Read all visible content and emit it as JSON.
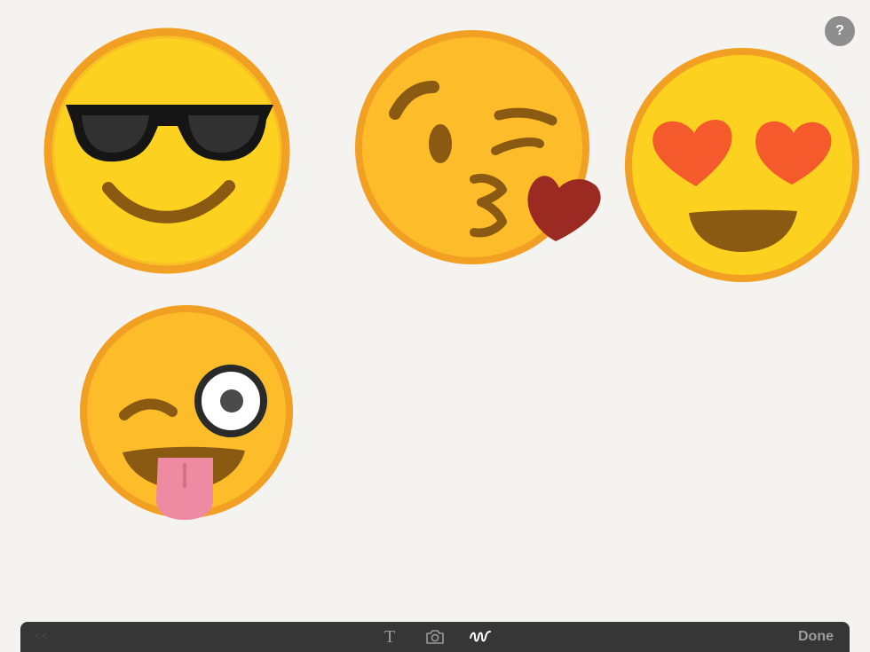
{
  "help": {
    "label": "?"
  },
  "toolbar": {
    "back_label": "<<",
    "text_tool_label": "T",
    "done_label": "Done",
    "tools": [
      "text-icon",
      "camera-icon",
      "draw-icon"
    ],
    "active_tool": "draw"
  },
  "drawing": {
    "items": [
      "cool-face-sunglasses",
      "face-blowing-kiss",
      "heart-eyes-face",
      "winking-tongue-face"
    ]
  },
  "colors": {
    "background": "#f5f3f0",
    "face_fill": "#fdd11f",
    "face_outline": "#f2a024",
    "mouth": "#8a5a12",
    "heart_red": "#f55a2d",
    "kiss_heart": "#9b2a22",
    "tongue": "#ee8ba2",
    "toolbar": "#363636",
    "active_tool": "#ffffff"
  }
}
